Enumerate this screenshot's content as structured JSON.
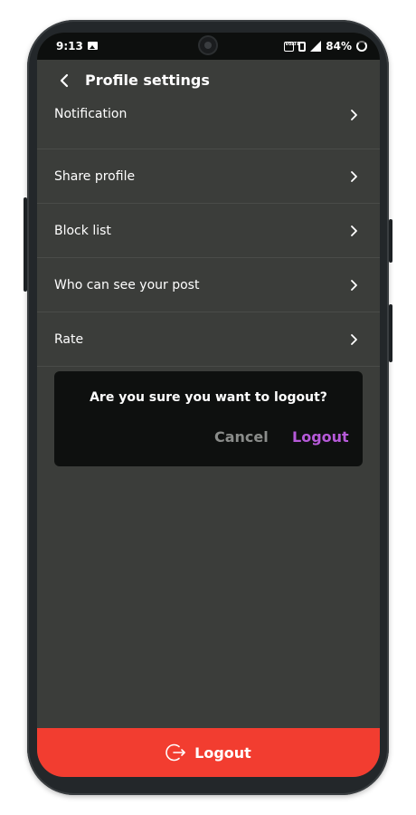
{
  "status_bar": {
    "time": "9:13",
    "volte": "VoLTE",
    "battery": "84%"
  },
  "header": {
    "title": "Profile settings"
  },
  "menu": {
    "items": [
      {
        "label": "Notification"
      },
      {
        "label": "Share profile"
      },
      {
        "label": "Block list"
      },
      {
        "label": "Who can see your post"
      },
      {
        "label": "Rate"
      }
    ]
  },
  "dialog": {
    "message": "Are you sure you want to logout?",
    "cancel_label": "Cancel",
    "confirm_label": "Logout"
  },
  "footer": {
    "logout_label": "Logout"
  },
  "colors": {
    "background": "#3b3d3a",
    "status_bar": "#0d0f0e",
    "dialog": "#0e100f",
    "accent": "#b65ad9",
    "logout_bar": "#f23d30"
  },
  "icons": [
    "image-icon",
    "volte-icon",
    "vibrate-icon",
    "signal-icon",
    "battery-icon",
    "back-arrow-icon",
    "chevron-right-icon",
    "logout-icon"
  ]
}
